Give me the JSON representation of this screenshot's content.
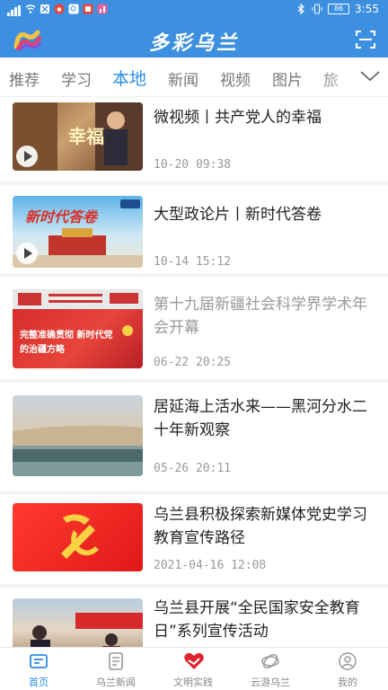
{
  "status": {
    "time": "3:55",
    "battery": "86"
  },
  "header": {
    "title": "多彩乌兰"
  },
  "tabs": [
    "推荐",
    "学习",
    "本地",
    "新闻",
    "视频",
    "图片",
    "旅"
  ],
  "active_tab": "本地",
  "articles": [
    {
      "title": "微视频丨共产党人的幸福",
      "time": "10-20 09:38",
      "video": true,
      "thumb_text": "幸福"
    },
    {
      "title": "大型政论片丨新时代答卷",
      "time": "10-14 15:12",
      "video": true,
      "thumb_text": "新时代答卷"
    },
    {
      "title": "第十九届新疆社会科学界学术年会开幕",
      "time": "06-22 20:25",
      "read": true,
      "thumb_text": "完整准确贯彻 新时代党的治疆方略"
    },
    {
      "title": "居延海上活水来——黑河分水二十年新观察",
      "time": "05-26 20:11"
    },
    {
      "title": "乌兰县积极探索新媒体党史学习教育宣传路径",
      "time": "2021-04-16 12:08"
    },
    {
      "title": "乌兰县开展“全民国家安全教育日”系列宣传活动",
      "time": ""
    }
  ],
  "nav": {
    "items": [
      {
        "label": "首页",
        "icon": "home-icon"
      },
      {
        "label": "乌兰新闻",
        "icon": "news-icon"
      },
      {
        "label": "文明实践",
        "icon": "heart-icon"
      },
      {
        "label": "云游乌兰",
        "icon": "tour-icon"
      },
      {
        "label": "我的",
        "icon": "user-icon"
      }
    ],
    "active": "首页"
  },
  "colors": {
    "accent": "#2a8ce6",
    "header": "#3d8fe0"
  }
}
